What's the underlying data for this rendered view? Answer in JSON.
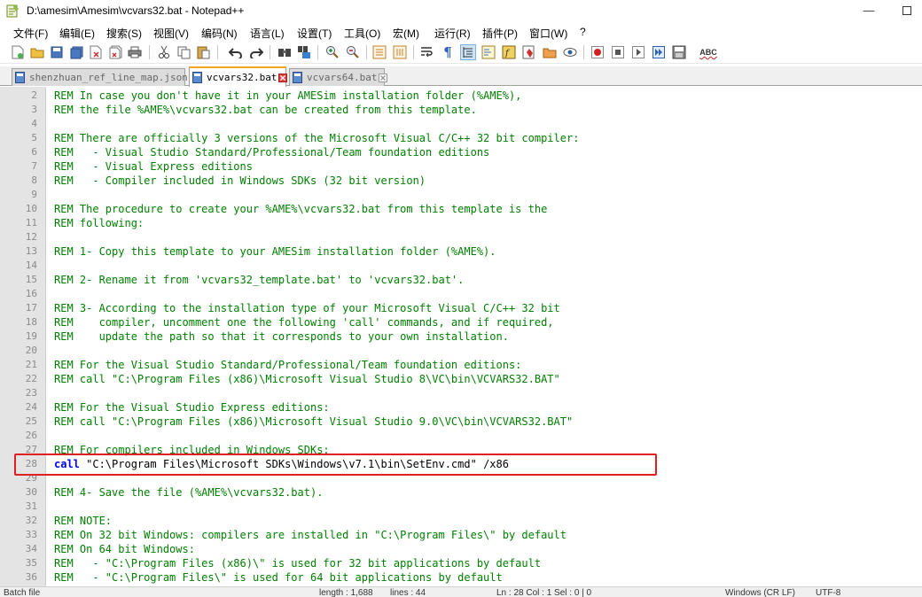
{
  "window": {
    "title": "D:\\amesim\\Amesim\\vcvars32.bat - Notepad++",
    "minimize_glyph": "—",
    "maximize_label": ""
  },
  "menu": [
    "文件(F)",
    "编辑(E)",
    "搜索(S)",
    "视图(V)",
    "编码(N)",
    "语言(L)",
    "设置(T)",
    "工具(O)",
    "宏(M)",
    "运行(R)",
    "插件(P)",
    "窗口(W)",
    "?"
  ],
  "toolbar": {
    "icons": [
      "new-file-icon",
      "open-file-icon",
      "save-icon",
      "save-all-icon",
      "close-icon",
      "close-all-icon",
      "print-icon",
      "cut-icon",
      "copy-icon",
      "paste-icon",
      "undo-icon",
      "redo-icon",
      "find-icon",
      "replace-icon",
      "zoom-in-icon",
      "zoom-out-icon",
      "sync-vertical-icon",
      "sync-horizontal-icon",
      "word-wrap-icon",
      "show-all-chars-icon",
      "indent-guide-icon",
      "doc-map-icon",
      "function-list-icon",
      "folder-workspace-icon",
      "monitor-icon",
      "record-macro-icon",
      "stop-record-icon",
      "play-macro-icon",
      "run-macro-multiple-icon",
      "save-macro-icon",
      "spell-check-icon"
    ],
    "spell_check_label": "ABC"
  },
  "tabs": [
    {
      "label": "shenzhuan_ref_line_map.json",
      "active": false
    },
    {
      "label": "vcvars32.bat",
      "active": true
    },
    {
      "label": "vcvars64.bat",
      "active": false
    }
  ],
  "colors": {
    "comment": "#008000",
    "keyword": "#0000ff",
    "highlight_box": "#e02020",
    "active_tab_accent": "#f5a623"
  },
  "editor": {
    "lines": [
      {
        "n": "2",
        "text": "REM In case you don't have it in your AMESim installation folder (%AME%),"
      },
      {
        "n": "3",
        "text": "REM the file %AME%\\vcvars32.bat can be created from this template."
      },
      {
        "n": "4",
        "text": ""
      },
      {
        "n": "5",
        "text": "REM There are officially 3 versions of the Microsoft Visual C/C++ 32 bit compiler:"
      },
      {
        "n": "6",
        "text": "REM   - Visual Studio Standard/Professional/Team foundation editions"
      },
      {
        "n": "7",
        "text": "REM   - Visual Express editions"
      },
      {
        "n": "8",
        "text": "REM   - Compiler included in Windows SDKs (32 bit version)"
      },
      {
        "n": "9",
        "text": ""
      },
      {
        "n": "10",
        "text": "REM The procedure to create your %AME%\\vcvars32.bat from this template is the"
      },
      {
        "n": "11",
        "text": "REM following:"
      },
      {
        "n": "12",
        "text": ""
      },
      {
        "n": "13",
        "text": "REM 1- Copy this template to your AMESim installation folder (%AME%)."
      },
      {
        "n": "14",
        "text": ""
      },
      {
        "n": "15",
        "text": "REM 2- Rename it from 'vcvars32_template.bat' to 'vcvars32.bat'."
      },
      {
        "n": "16",
        "text": ""
      },
      {
        "n": "17",
        "text": "REM 3- According to the installation type of your Microsoft Visual C/C++ 32 bit"
      },
      {
        "n": "18",
        "text": "REM    compiler, uncomment one the following 'call' commands, and if required,"
      },
      {
        "n": "19",
        "text": "REM    update the path so that it corresponds to your own installation."
      },
      {
        "n": "20",
        "text": ""
      },
      {
        "n": "21",
        "text": "REM For the Visual Studio Standard/Professional/Team foundation editions:"
      },
      {
        "n": "22",
        "text": "REM call \"C:\\Program Files (x86)\\Microsoft Visual Studio 8\\VC\\bin\\VCVARS32.BAT\""
      },
      {
        "n": "23",
        "text": ""
      },
      {
        "n": "24",
        "text": "REM For the Visual Studio Express editions:"
      },
      {
        "n": "25",
        "text": "REM call \"C:\\Program Files (x86)\\Microsoft Visual Studio 9.0\\VC\\bin\\VCVARS32.BAT\""
      },
      {
        "n": "26",
        "text": ""
      },
      {
        "n": "27",
        "text": "REM For compilers included in Windows SDKs:"
      },
      {
        "n": "28",
        "kw": "call",
        "str": " \"C:\\Program Files\\Microsoft SDKs\\Windows\\v7.1\\bin\\SetEnv.cmd\"",
        "plain": " /x86"
      },
      {
        "n": "29",
        "text": ""
      },
      {
        "n": "30",
        "text": "REM 4- Save the file (%AME%\\vcvars32.bat)."
      },
      {
        "n": "31",
        "text": ""
      },
      {
        "n": "32",
        "text": "REM NOTE:"
      },
      {
        "n": "33",
        "text": "REM On 32 bit Windows: compilers are installed in \"C:\\Program Files\\\" by default"
      },
      {
        "n": "34",
        "text": "REM On 64 bit Windows:"
      },
      {
        "n": "35",
        "text": "REM   - \"C:\\Program Files (x86)\\\" is used for 32 bit applications by default"
      },
      {
        "n": "36",
        "text": "REM   - \"C:\\Program Files\\\" is used for 64 bit applications by default"
      }
    ]
  },
  "status": {
    "file_type": "Batch file",
    "length": "length : 1,688",
    "lines": "lines : 44",
    "position": "Ln : 28    Col : 1    Sel : 0 | 0",
    "eol": "Windows (CR LF)",
    "encoding": "UTF-8"
  }
}
